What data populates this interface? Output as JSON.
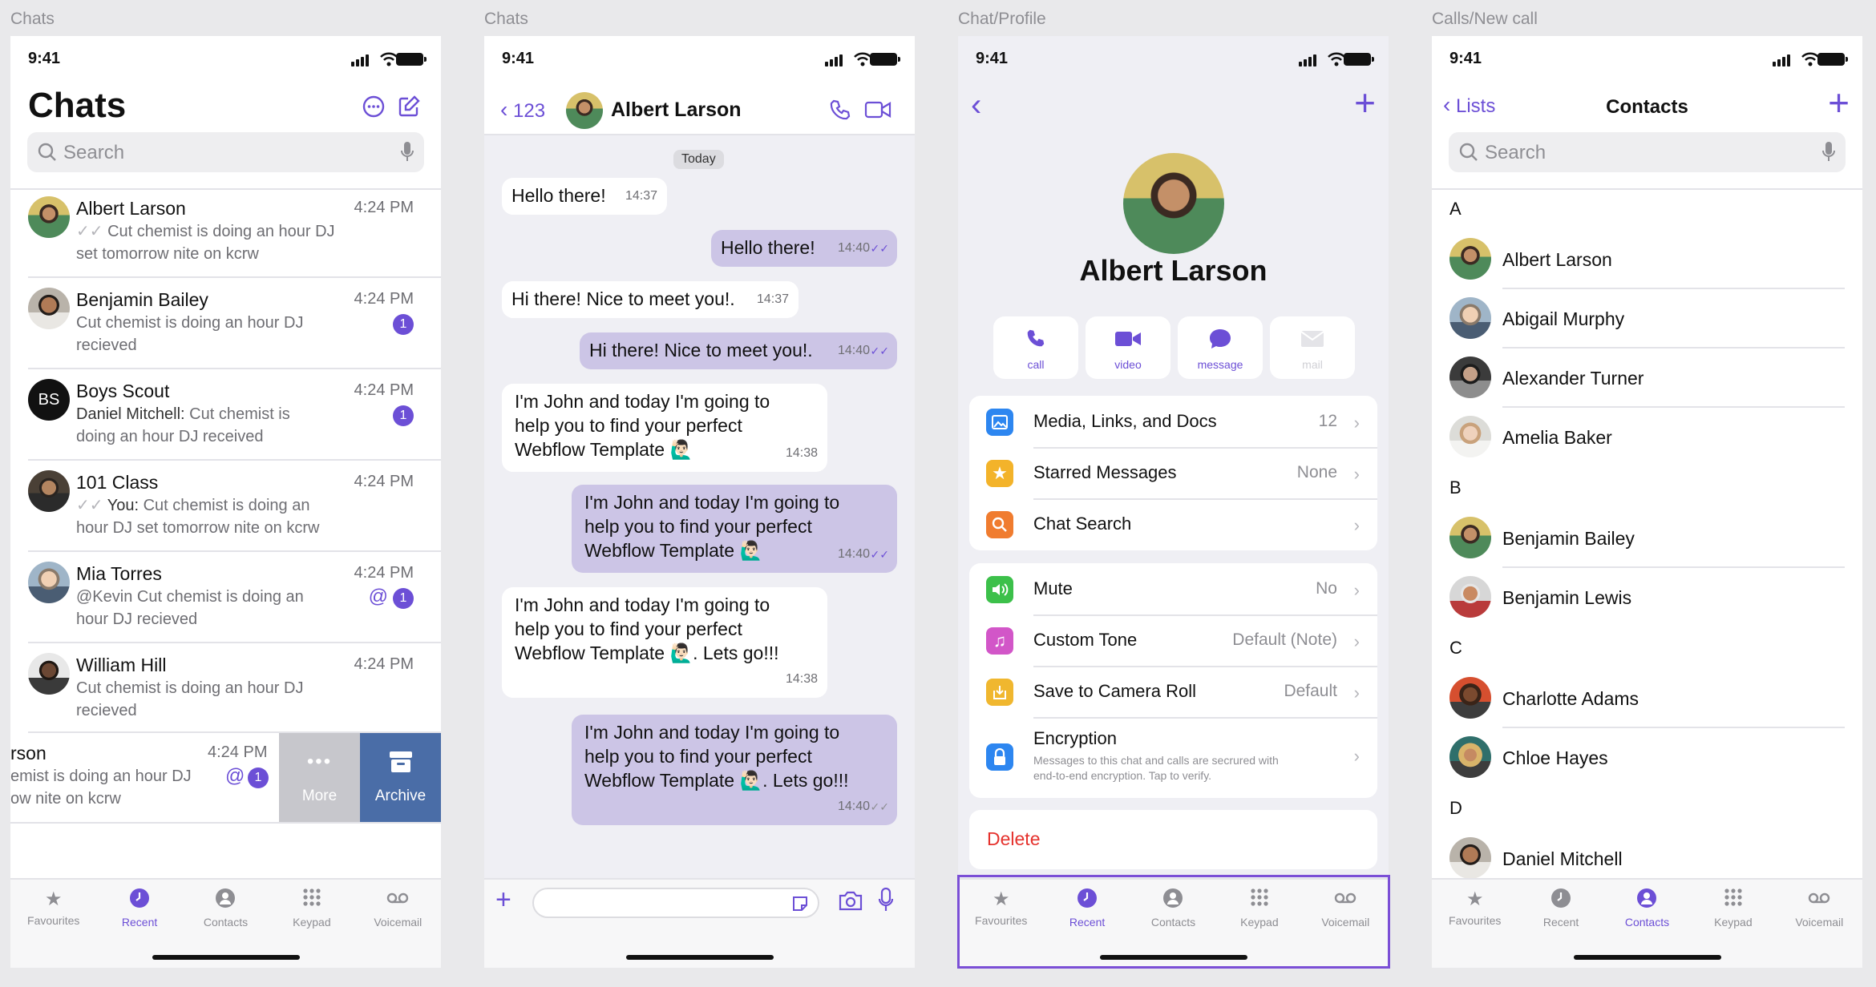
{
  "frames": [
    "Chats",
    "Chats",
    "Chat/Profile",
    "Calls/New call"
  ],
  "status": {
    "time": "9:41"
  },
  "chats": {
    "title": "Chats",
    "search_placeholder": "Search",
    "items": [
      {
        "name": "Albert Larson",
        "time": "4:24 PM",
        "preview1": "Cut chemist is doing an hour DJ",
        "preview2": "set tomorrow nite on kcrw"
      },
      {
        "name": "Benjamin Bailey",
        "time": "4:24 PM",
        "preview1": "Cut chemist is doing an hour DJ",
        "preview2": "recieved",
        "badge": "1"
      },
      {
        "name": "Boys Scout",
        "initials": "BS",
        "time": "4:24 PM",
        "sender": "Daniel Mitchell:",
        "preview1": " Cut chemist is",
        "preview2": "doing an hour DJ received",
        "badge": "1"
      },
      {
        "name": "101 Class",
        "time": "4:24 PM",
        "sender": "You:",
        "preview1": " Cut chemist is doing an",
        "preview2": "hour DJ set tomorrow nite on kcrw"
      },
      {
        "name": "Mia Torres",
        "time": "4:24 PM",
        "preview1": "@Kevin Cut chemist is doing an",
        "preview2": "hour DJ recieved",
        "badge": "1",
        "mention": "@"
      },
      {
        "name": "William Hill",
        "time": "4:24 PM",
        "preview1": "Cut chemist is doing an hour DJ",
        "preview2": "recieved"
      }
    ],
    "swiped": {
      "name": "rson",
      "time": "4:24 PM",
      "preview1": "emist is doing an hour DJ",
      "preview2": "ow nite on kcrw",
      "mention": "@",
      "badge": "1",
      "more": "More",
      "archive": "Archive"
    }
  },
  "tabs": [
    "Favourites",
    "Recent",
    "Contacts",
    "Keypad",
    "Voicemail"
  ],
  "conversation": {
    "back": "123",
    "name": "Albert Larson",
    "date": "Today",
    "messages": [
      {
        "text": "Hello there!",
        "time": "14:37"
      },
      {
        "text": "Hello there!",
        "time": "14:40"
      },
      {
        "text": "Hi there! Nice to meet you!.",
        "time": "14:37"
      },
      {
        "text": "Hi there! Nice to meet you!.",
        "time": "14:40"
      },
      {
        "l1": "I'm John and today I'm going to",
        "l2": "help you to find your perfect",
        "l3": "Webflow Template 🙋🏻‍♂️",
        "time": "14:38"
      },
      {
        "l1": "I'm John and today I'm going to",
        "l2": "help you to find your perfect",
        "l3": "Webflow Template 🙋🏻‍♂️",
        "time": "14:40"
      },
      {
        "l1": "I'm John and today I'm going to",
        "l2": "help you to find your perfect",
        "l3": "Webflow Template 🙋🏻‍♂️. Lets go!!!",
        "time": "14:38"
      },
      {
        "l1": "I'm John and today I'm going to",
        "l2": "help you to find your perfect",
        "l3": "Webflow Template 🙋🏻‍♂️. Lets go!!!",
        "time": "14:40"
      }
    ]
  },
  "profile": {
    "name": "Albert Larson",
    "actions": [
      "call",
      "video",
      "message",
      "mail"
    ],
    "group1": [
      {
        "label": "Media, Links, and Docs",
        "value": "12"
      },
      {
        "label": "Starred Messages",
        "value": "None"
      },
      {
        "label": "Chat Search",
        "value": ""
      }
    ],
    "group2": [
      {
        "label": "Mute",
        "value": "No"
      },
      {
        "label": "Custom Tone",
        "value": "Default (Note)"
      },
      {
        "label": "Save to Camera Roll",
        "value": "Default"
      }
    ],
    "encryption": {
      "label": "Encryption",
      "line1": "Messages to this chat and calls are secrured with",
      "line2": "end-to-end encryption. Tap to verify."
    },
    "delete": "Delete"
  },
  "contacts": {
    "back": "Lists",
    "title": "Contacts",
    "search_placeholder": "Search",
    "sections": [
      {
        "letter": "A",
        "names": [
          "Albert Larson",
          "Abigail Murphy",
          "Alexander Turner",
          "Amelia Baker"
        ]
      },
      {
        "letter": "B",
        "names": [
          "Benjamin Bailey",
          "Benjamin Lewis"
        ]
      },
      {
        "letter": "C",
        "names": [
          "Charlotte Adams",
          "Chloe Hayes"
        ]
      },
      {
        "letter": "D",
        "names": [
          "Daniel Mitchell"
        ]
      }
    ]
  },
  "colors": {
    "accent": "#6c4fd6",
    "bubble_out": "#ccc5e6",
    "delete": "#e5322d",
    "highlight": "#7b4fd6"
  }
}
